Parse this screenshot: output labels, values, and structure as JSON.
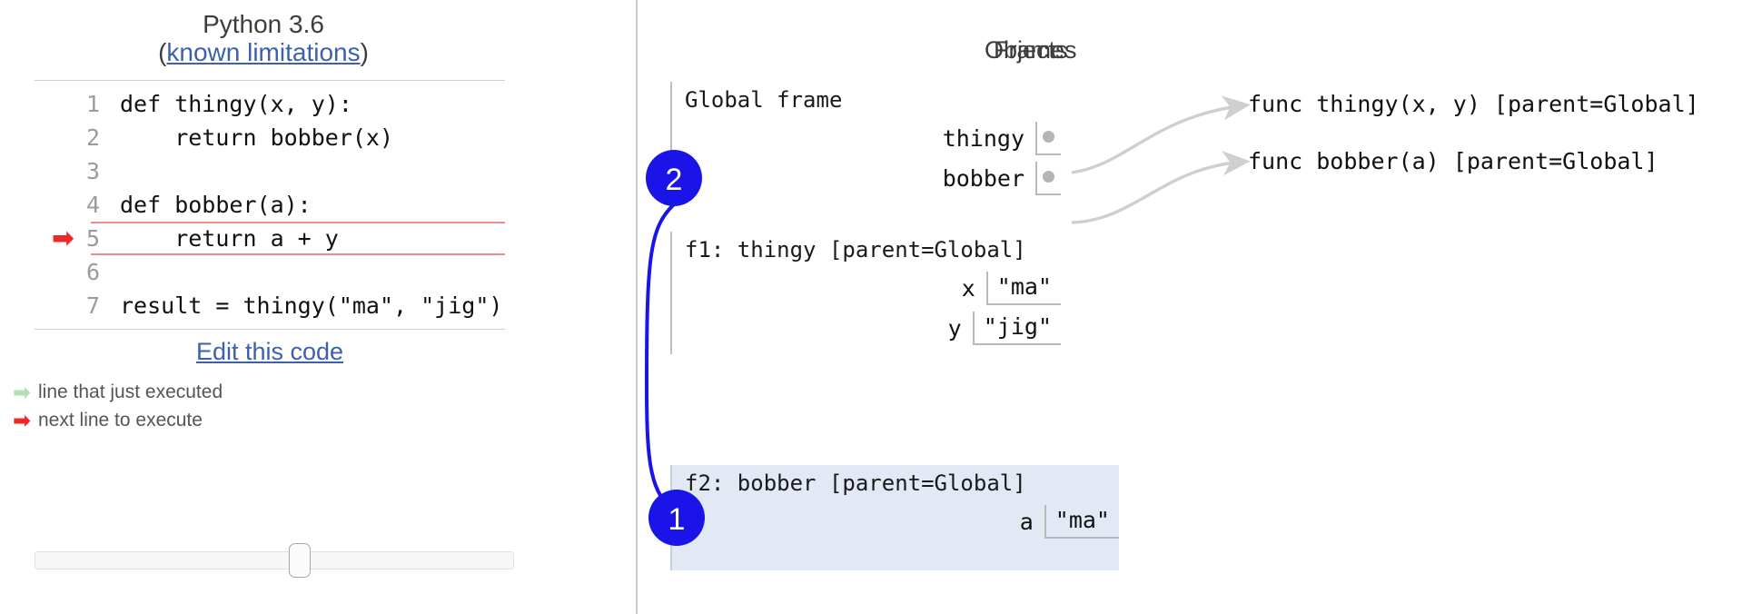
{
  "left_pane": {
    "python_version": "Python 3.6",
    "limitations_prefix": "(",
    "limitations_link": "known limitations",
    "limitations_suffix": ")",
    "code_lines": [
      {
        "number": "1",
        "text": "def thingy(x, y):",
        "highlighted": false,
        "arrow": ""
      },
      {
        "number": "2",
        "text": "    return bobber(x)",
        "highlighted": false,
        "arrow": ""
      },
      {
        "number": "3",
        "text": "",
        "highlighted": false,
        "arrow": ""
      },
      {
        "number": "4",
        "text": "def bobber(a):",
        "highlighted": false,
        "arrow": ""
      },
      {
        "number": "5",
        "text": "    return a + y",
        "highlighted": true,
        "arrow": "➡"
      },
      {
        "number": "6",
        "text": "",
        "highlighted": false,
        "arrow": ""
      },
      {
        "number": "7",
        "text": "result = thingy(\"ma\", \"jig\")",
        "highlighted": false,
        "arrow": ""
      }
    ],
    "edit_code_label": "Edit this code",
    "legend": {
      "executed_arrow": "➡",
      "executed_label": "line that just executed",
      "next_arrow": "➡",
      "next_label": "next line to execute"
    }
  },
  "right_pane": {
    "frames_heading": "Frames",
    "objects_heading": "Objects",
    "frames": [
      {
        "title": "Global frame",
        "highlighted": false,
        "vars": [
          {
            "name": "thingy",
            "value": "",
            "is_pointer": true
          },
          {
            "name": "bobber",
            "value": "",
            "is_pointer": true
          }
        ]
      },
      {
        "title": "f1: thingy [parent=Global]",
        "highlighted": false,
        "vars": [
          {
            "name": "x",
            "value": "\"ma\"",
            "is_pointer": false
          },
          {
            "name": "y",
            "value": "\"jig\"",
            "is_pointer": false
          }
        ]
      },
      {
        "title": "f2: bobber [parent=Global]",
        "highlighted": true,
        "vars": [
          {
            "name": "a",
            "value": "\"ma\"",
            "is_pointer": false
          }
        ]
      }
    ],
    "objects": [
      {
        "text": "func thingy(x, y) [parent=Global]"
      },
      {
        "text": "func bobber(a) [parent=Global]"
      }
    ]
  },
  "annotations": [
    {
      "number": "2"
    },
    {
      "number": "1"
    }
  ],
  "colors": {
    "link": "#3d5fb0",
    "next_line_arrow": "#ef2929",
    "executed_line_arrow": "#b3e0b3",
    "highlight_frame_bg": "#e2e8f4",
    "annotation_blue": "#1a14e8",
    "code_highlight_border": "#f08c8c"
  }
}
